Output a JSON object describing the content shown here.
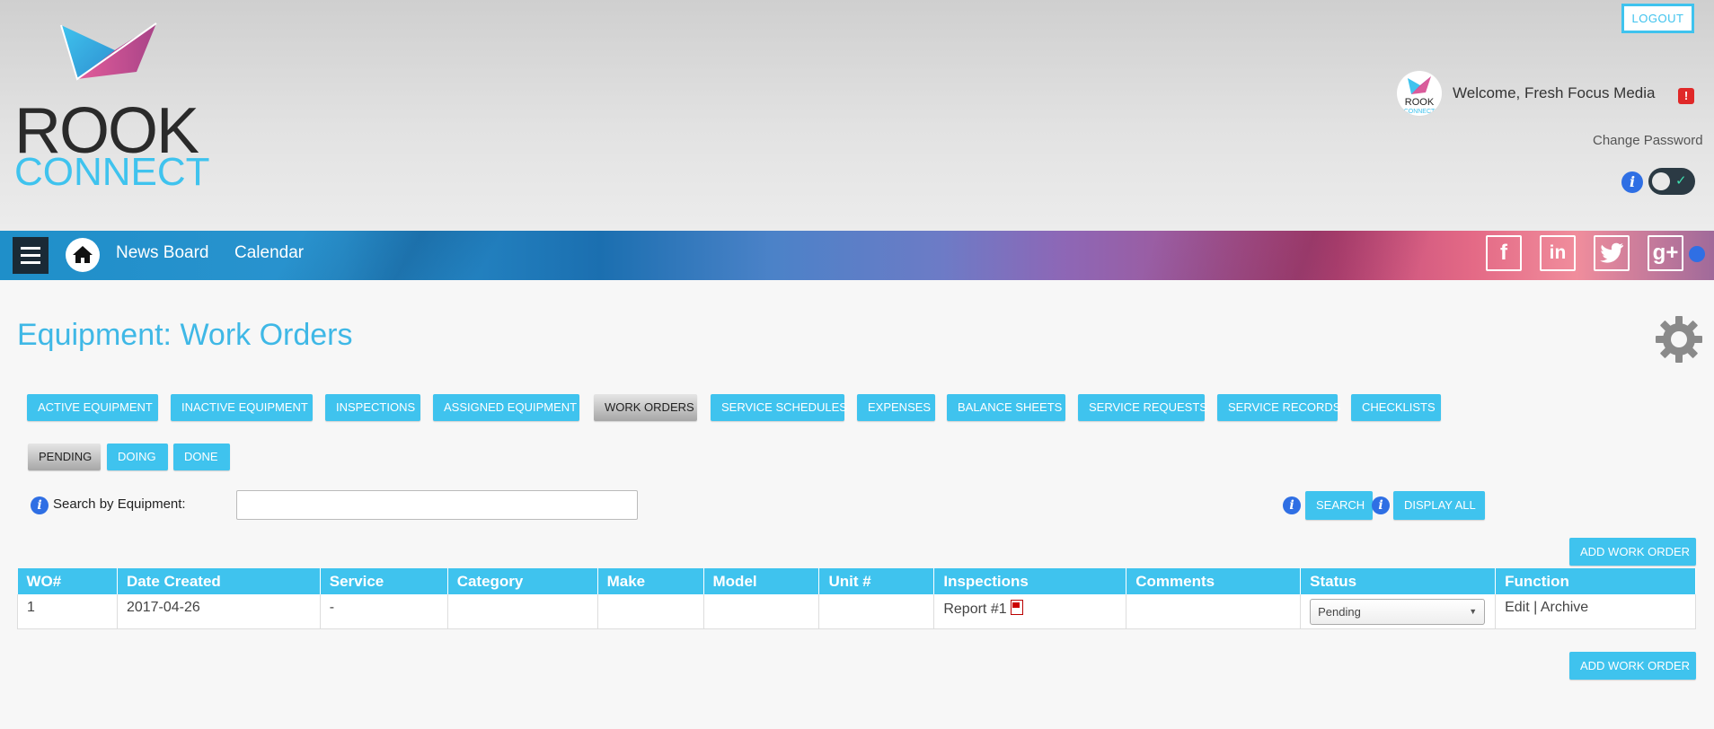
{
  "brand": {
    "word1": "ROOK",
    "word2": "CONNECT",
    "accent": "#3fc3ee"
  },
  "header": {
    "logout_label": "LOGOUT",
    "welcome": "Welcome, Fresh Focus Media",
    "alert_glyph": "!",
    "change_password": "Change Password",
    "info_glyph": "i",
    "toggle_state": "on"
  },
  "nav": {
    "menu_icon": "hamburger-icon",
    "home_icon": "home-icon",
    "links": [
      "News Board",
      "Calendar"
    ],
    "social": [
      {
        "name": "facebook-icon",
        "glyph": "f"
      },
      {
        "name": "linkedin-icon",
        "glyph": "in"
      },
      {
        "name": "twitter-icon",
        "glyph": "🐦"
      },
      {
        "name": "googleplus-icon",
        "glyph": "g+"
      }
    ]
  },
  "main": {
    "title": "Equipment: Work Orders",
    "tabs": [
      {
        "label": "ACTIVE EQUIPMENT",
        "active": false
      },
      {
        "label": "INACTIVE EQUIPMENT",
        "active": false
      },
      {
        "label": "INSPECTIONS",
        "active": false
      },
      {
        "label": "ASSIGNED EQUIPMENT",
        "active": false
      },
      {
        "label": "WORK ORDERS",
        "active": true
      },
      {
        "label": "SERVICE SCHEDULES",
        "active": false
      },
      {
        "label": "EXPENSES",
        "active": false
      },
      {
        "label": "BALANCE SHEETS",
        "active": false
      },
      {
        "label": "SERVICE REQUESTS",
        "active": false
      },
      {
        "label": "SERVICE RECORDS",
        "active": false
      },
      {
        "label": "CHECKLISTS",
        "active": false
      }
    ],
    "subtabs": [
      {
        "label": "PENDING",
        "active": true
      },
      {
        "label": "DOING",
        "active": false
      },
      {
        "label": "DONE",
        "active": false
      }
    ],
    "search": {
      "label": "Search by Equipment:",
      "value": "",
      "placeholder": "",
      "search_button": "SEARCH",
      "display_all_button": "DISPLAY ALL"
    },
    "add_button": "ADD WORK ORDER",
    "table": {
      "columns": [
        "WO#",
        "Date Created",
        "Service",
        "Category",
        "Make",
        "Model",
        "Unit #",
        "Inspections",
        "Comments",
        "Status",
        "Function"
      ],
      "rows": [
        {
          "wo": "1",
          "date": "2017-04-26",
          "service": "-",
          "category": "",
          "make": "",
          "model": "",
          "unit": "",
          "inspection": "Report #1",
          "comments": "",
          "status": "Pending",
          "edit": "Edit",
          "sep": "|",
          "archive": "Archive"
        }
      ]
    }
  }
}
